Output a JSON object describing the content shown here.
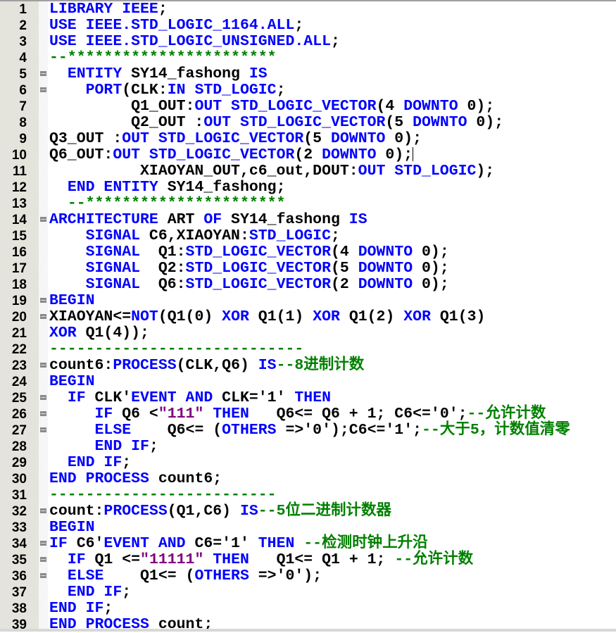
{
  "colors": {
    "keyword": "#0000ff",
    "text": "#000000",
    "comment": "#008000",
    "string": "#800080"
  },
  "cursor_line": 10,
  "lines": [
    {
      "n": "1",
      "fold": false,
      "tokens": [
        [
          "k",
          "LIBRARY IEEE"
        ],
        [
          "t",
          ";"
        ]
      ]
    },
    {
      "n": "2",
      "fold": false,
      "tokens": [
        [
          "k",
          "USE IEEE.STD_LOGIC_1164.ALL"
        ],
        [
          "t",
          ";"
        ]
      ]
    },
    {
      "n": "3",
      "fold": false,
      "tokens": [
        [
          "k",
          "USE IEEE.STD_LOGIC_UNSIGNED.ALL"
        ],
        [
          "t",
          ";"
        ]
      ]
    },
    {
      "n": "4",
      "fold": false,
      "tokens": [
        [
          "c",
          "--***********************"
        ]
      ]
    },
    {
      "n": "5",
      "fold": true,
      "tokens": [
        [
          "t",
          "  "
        ],
        [
          "k",
          "ENTITY"
        ],
        [
          "t",
          " SY14_fashong "
        ],
        [
          "k",
          "IS"
        ]
      ]
    },
    {
      "n": "6",
      "fold": true,
      "tokens": [
        [
          "t",
          "    "
        ],
        [
          "k",
          "PORT"
        ],
        [
          "t",
          "(CLK:"
        ],
        [
          "k",
          "IN STD_LOGIC"
        ],
        [
          "t",
          ";"
        ]
      ]
    },
    {
      "n": "7",
      "fold": false,
      "tokens": [
        [
          "t",
          "         Q1_OUT:"
        ],
        [
          "k",
          "OUT STD_LOGIC_VECTOR"
        ],
        [
          "t",
          "(4 "
        ],
        [
          "k",
          "DOWNTO"
        ],
        [
          "t",
          " 0);"
        ]
      ]
    },
    {
      "n": "8",
      "fold": false,
      "tokens": [
        [
          "t",
          "         Q2_OUT :"
        ],
        [
          "k",
          "OUT STD_LOGIC_VECTOR"
        ],
        [
          "t",
          "(5 "
        ],
        [
          "k",
          "DOWNTO"
        ],
        [
          "t",
          " 0);"
        ]
      ]
    },
    {
      "n": "9",
      "fold": false,
      "tokens": [
        [
          "t",
          "Q3_OUT :"
        ],
        [
          "k",
          "OUT STD_LOGIC_VECTOR"
        ],
        [
          "t",
          "(5 "
        ],
        [
          "k",
          "DOWNTO"
        ],
        [
          "t",
          " 0);"
        ]
      ]
    },
    {
      "n": "10",
      "fold": false,
      "tokens": [
        [
          "t",
          "Q6_OUT:"
        ],
        [
          "k",
          "OUT STD_LOGIC_VECTOR"
        ],
        [
          "t",
          "(2 "
        ],
        [
          "k",
          "DOWNTO"
        ],
        [
          "t",
          " 0);"
        ]
      ]
    },
    {
      "n": "11",
      "fold": false,
      "tokens": [
        [
          "t",
          "          XIAOYAN_OUT,c6_out,DOUT:"
        ],
        [
          "k",
          "OUT STD_LOGIC"
        ],
        [
          "t",
          ");"
        ]
      ]
    },
    {
      "n": "12",
      "fold": false,
      "tokens": [
        [
          "t",
          "  "
        ],
        [
          "k",
          "END ENTITY"
        ],
        [
          "t",
          " SY14_fashong;"
        ]
      ]
    },
    {
      "n": "13",
      "fold": false,
      "tokens": [
        [
          "t",
          "  "
        ],
        [
          "c",
          "--**********************"
        ]
      ]
    },
    {
      "n": "14",
      "fold": true,
      "tokens": [
        [
          "k",
          "ARCHITECTURE"
        ],
        [
          "t",
          " ART "
        ],
        [
          "k",
          "OF"
        ],
        [
          "t",
          " SY14_fashong "
        ],
        [
          "k",
          "IS"
        ]
      ]
    },
    {
      "n": "15",
      "fold": false,
      "tokens": [
        [
          "t",
          "    "
        ],
        [
          "k",
          "SIGNAL"
        ],
        [
          "t",
          " C6,XIAOYAN:"
        ],
        [
          "k",
          "STD_LOGIC"
        ],
        [
          "t",
          ";"
        ]
      ]
    },
    {
      "n": "16",
      "fold": false,
      "tokens": [
        [
          "t",
          "    "
        ],
        [
          "k",
          "SIGNAL"
        ],
        [
          "t",
          "  Q1:"
        ],
        [
          "k",
          "STD_LOGIC_VECTOR"
        ],
        [
          "t",
          "(4 "
        ],
        [
          "k",
          "DOWNTO"
        ],
        [
          "t",
          " 0);"
        ]
      ]
    },
    {
      "n": "17",
      "fold": false,
      "tokens": [
        [
          "t",
          "    "
        ],
        [
          "k",
          "SIGNAL"
        ],
        [
          "t",
          "  Q2:"
        ],
        [
          "k",
          "STD_LOGIC_VECTOR"
        ],
        [
          "t",
          "(5 "
        ],
        [
          "k",
          "DOWNTO"
        ],
        [
          "t",
          " 0);"
        ]
      ]
    },
    {
      "n": "18",
      "fold": false,
      "tokens": [
        [
          "t",
          "    "
        ],
        [
          "k",
          "SIGNAL"
        ],
        [
          "t",
          "  Q6:"
        ],
        [
          "k",
          "STD_LOGIC_VECTOR"
        ],
        [
          "t",
          "(2 "
        ],
        [
          "k",
          "DOWNTO"
        ],
        [
          "t",
          " 0);"
        ]
      ]
    },
    {
      "n": "19",
      "fold": true,
      "tokens": [
        [
          "k",
          "BEGIN"
        ]
      ]
    },
    {
      "n": "20",
      "fold": true,
      "tokens": [
        [
          "t",
          "XIAOYAN<="
        ],
        [
          "k",
          "NOT"
        ],
        [
          "t",
          "(Q1(0) "
        ],
        [
          "k",
          "XOR"
        ],
        [
          "t",
          " Q1(1) "
        ],
        [
          "k",
          "XOR"
        ],
        [
          "t",
          " Q1(2) "
        ],
        [
          "k",
          "XOR"
        ],
        [
          "t",
          " Q1(3)"
        ]
      ]
    },
    {
      "n": "21",
      "fold": false,
      "tokens": [
        [
          "k",
          "XOR"
        ],
        [
          "t",
          " Q1(4));"
        ]
      ]
    },
    {
      "n": "22",
      "fold": false,
      "tokens": [
        [
          "c",
          "----------------------------"
        ]
      ]
    },
    {
      "n": "23",
      "fold": true,
      "tokens": [
        [
          "t",
          "count6:"
        ],
        [
          "k",
          "PROCESS"
        ],
        [
          "t",
          "(CLK,Q6) "
        ],
        [
          "k",
          "IS"
        ],
        [
          "c",
          "--8进制计数"
        ]
      ]
    },
    {
      "n": "24",
      "fold": false,
      "tokens": [
        [
          "k",
          "BEGIN"
        ]
      ]
    },
    {
      "n": "25",
      "fold": true,
      "tokens": [
        [
          "t",
          "  "
        ],
        [
          "k",
          "IF"
        ],
        [
          "t",
          " CLK'"
        ],
        [
          "k",
          "EVENT AND"
        ],
        [
          "t",
          " CLK='1' "
        ],
        [
          "k",
          "THEN"
        ]
      ]
    },
    {
      "n": "26",
      "fold": true,
      "tokens": [
        [
          "t",
          "     "
        ],
        [
          "k",
          "IF"
        ],
        [
          "t",
          " Q6 <"
        ],
        [
          "s",
          "\"111\""
        ],
        [
          "t",
          " "
        ],
        [
          "k",
          "THEN"
        ],
        [
          "t",
          "   Q6<= Q6 + 1; C6<='0';"
        ],
        [
          "c",
          "--允许计数"
        ]
      ]
    },
    {
      "n": "27",
      "fold": true,
      "tokens": [
        [
          "t",
          "     "
        ],
        [
          "k",
          "ELSE"
        ],
        [
          "t",
          "    Q6<= ("
        ],
        [
          "k",
          "OTHERS"
        ],
        [
          "t",
          " =>'0');C6<='1';"
        ],
        [
          "c",
          "--大于5，计数值清零"
        ]
      ]
    },
    {
      "n": "28",
      "fold": false,
      "tokens": [
        [
          "t",
          "     "
        ],
        [
          "k",
          "END IF"
        ],
        [
          "t",
          ";"
        ]
      ]
    },
    {
      "n": "29",
      "fold": false,
      "tokens": [
        [
          "t",
          "  "
        ],
        [
          "k",
          "END IF"
        ],
        [
          "t",
          ";"
        ]
      ]
    },
    {
      "n": "30",
      "fold": false,
      "tokens": [
        [
          "k",
          "END PROCESS"
        ],
        [
          "t",
          " count6;"
        ]
      ]
    },
    {
      "n": "31",
      "fold": false,
      "tokens": [
        [
          "c",
          "-------------------------"
        ]
      ]
    },
    {
      "n": "32",
      "fold": true,
      "tokens": [
        [
          "t",
          "count:"
        ],
        [
          "k",
          "PROCESS"
        ],
        [
          "t",
          "(Q1,C6) "
        ],
        [
          "k",
          "IS"
        ],
        [
          "c",
          "--5位二进制计数器"
        ]
      ]
    },
    {
      "n": "33",
      "fold": false,
      "tokens": [
        [
          "k",
          "BEGIN"
        ]
      ]
    },
    {
      "n": "34",
      "fold": true,
      "tokens": [
        [
          "k",
          "IF"
        ],
        [
          "t",
          " C6'"
        ],
        [
          "k",
          "EVENT AND"
        ],
        [
          "t",
          " C6='1' "
        ],
        [
          "k",
          "THEN"
        ],
        [
          "t",
          " "
        ],
        [
          "c",
          "--检测时钟上升沿"
        ]
      ]
    },
    {
      "n": "35",
      "fold": true,
      "tokens": [
        [
          "t",
          "  "
        ],
        [
          "k",
          "IF"
        ],
        [
          "t",
          " Q1 <="
        ],
        [
          "s",
          "\"11111\""
        ],
        [
          "t",
          " "
        ],
        [
          "k",
          "THEN"
        ],
        [
          "t",
          "   Q1<= Q1 + 1; "
        ],
        [
          "c",
          "--允许计数"
        ]
      ]
    },
    {
      "n": "36",
      "fold": true,
      "tokens": [
        [
          "t",
          "  "
        ],
        [
          "k",
          "ELSE"
        ],
        [
          "t",
          "    Q1<= ("
        ],
        [
          "k",
          "OTHERS"
        ],
        [
          "t",
          " =>'0');"
        ]
      ]
    },
    {
      "n": "37",
      "fold": false,
      "tokens": [
        [
          "t",
          "  "
        ],
        [
          "k",
          "END IF"
        ],
        [
          "t",
          ";"
        ]
      ]
    },
    {
      "n": "38",
      "fold": false,
      "tokens": [
        [
          "k",
          "END IF"
        ],
        [
          "t",
          ";"
        ]
      ]
    },
    {
      "n": "39",
      "fold": false,
      "tokens": [
        [
          "k",
          "END PROCESS"
        ],
        [
          "t",
          " count;"
        ]
      ]
    }
  ]
}
